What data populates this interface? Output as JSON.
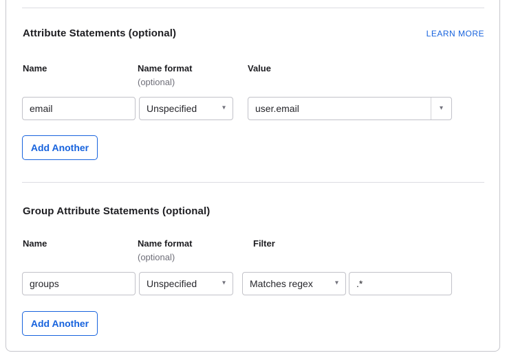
{
  "page": {
    "learn_more_label": "LEARN MORE"
  },
  "colors": {
    "accent_blue": "#1662dd",
    "text_dark": "#1d1d21",
    "text_muted": "#6e6e78",
    "input_border": "#c1c1c8",
    "divider": "#dcdce1"
  },
  "icons": {
    "dropdown_caret": "▾"
  },
  "attribute_statements": {
    "title": "Attribute Statements (optional)",
    "columns": {
      "name": "Name",
      "name_format": "Name format",
      "name_format_note": "(optional)",
      "value": "Value"
    },
    "row": {
      "name": "email",
      "name_format": "Unspecified",
      "value": "user.email"
    },
    "add_button_label": "Add Another"
  },
  "group_attribute_statements": {
    "title": "Group Attribute Statements (optional)",
    "columns": {
      "name": "Name",
      "name_format": "Name format",
      "name_format_note": "(optional)",
      "filter": "Filter"
    },
    "row": {
      "name": "groups",
      "name_format": "Unspecified",
      "filter_type": "Matches regex",
      "filter_value": ".*"
    },
    "add_button_label": "Add Another"
  }
}
